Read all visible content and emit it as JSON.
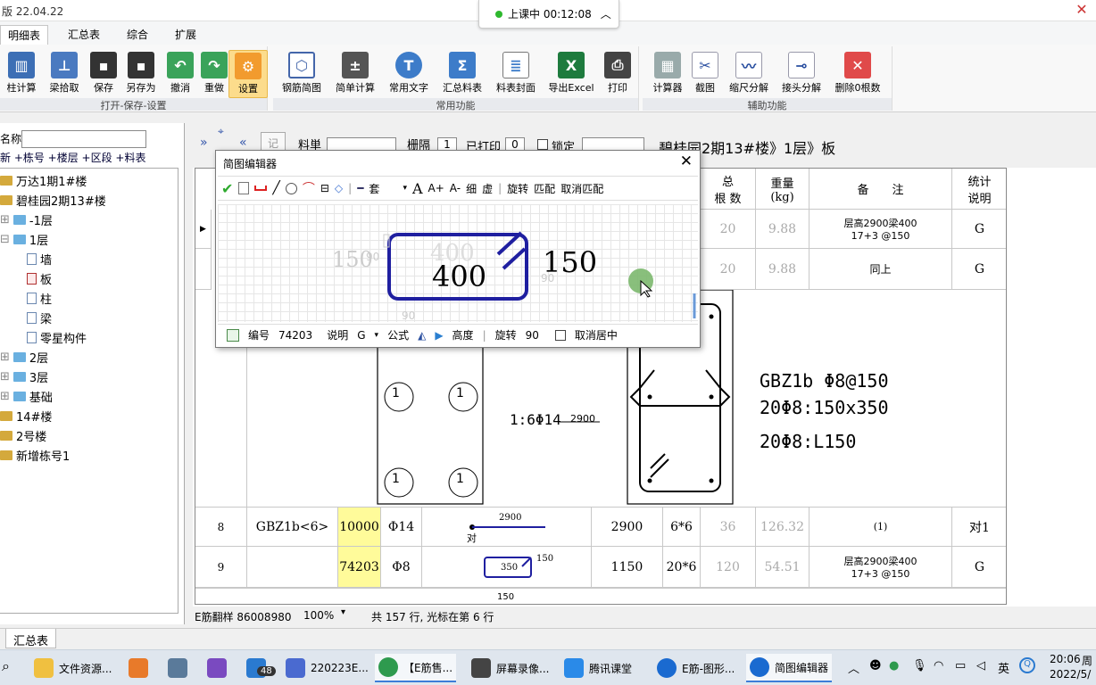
{
  "titlebar": {
    "title": "版 22.04.22"
  },
  "class_indicator": {
    "text": "上课中 00:12:08",
    "chevron": "^"
  },
  "menu_tabs": [
    "明细表",
    "汇总表",
    "综合",
    "扩展"
  ],
  "ribbon": {
    "groups": [
      {
        "label": "打开-保存-设置",
        "buttons": [
          "柱计算",
          "梁拾取",
          "保存",
          "另存为",
          "撤消",
          "重做",
          "设置"
        ]
      },
      {
        "label": "常用功能",
        "buttons": [
          "钢筋简图",
          "简单计算",
          "常用文字",
          "汇总料表",
          "料表封面",
          "导出Excel",
          "打印"
        ]
      },
      {
        "label": "辅助功能",
        "buttons": [
          "计算器",
          "截图",
          "缩尺分解",
          "接头分解",
          "删除0根数"
        ]
      }
    ]
  },
  "left_panel": {
    "search_label": "名称",
    "links": "新  +栋号  +楼层  +区段  +料表",
    "tree": [
      {
        "label": "万达1期1#楼"
      },
      {
        "label": "碧桂园2期13#楼"
      },
      {
        "label": "-1层"
      },
      {
        "label": "1层"
      },
      {
        "label": "墙"
      },
      {
        "label": "板"
      },
      {
        "label": "柱"
      },
      {
        "label": "梁"
      },
      {
        "label": "零星构件"
      },
      {
        "label": "2层"
      },
      {
        "label": "3层"
      },
      {
        "label": "基础"
      },
      {
        "label": "14#楼"
      },
      {
        "label": "2号楼"
      },
      {
        "label": "新增栋号1"
      }
    ]
  },
  "breadcrumb": {
    "labels": [
      "料単",
      "栅隔",
      "已打印",
      "锁定"
    ],
    "values": [
      "1",
      "0"
    ],
    "path": "碧桂园2期13#楼》1层》板"
  },
  "grid": {
    "headers": {
      "count": "总\n根 数",
      "weight": "重量\n(kg)",
      "remark": "备　　注",
      "stat": "统计\n说明"
    },
    "top_rows": [
      {
        "count": "20",
        "weight": "9.88",
        "remark": "层高2900梁400\n17+3 @150",
        "stat": "G"
      },
      {
        "count": "20",
        "weight": "9.88",
        "remark": "同上",
        "stat": "G"
      }
    ],
    "drawing": {
      "ratio_text": "1:6Φ14",
      "len_text": "2900",
      "notes": [
        "GBZ1b  Φ8@150",
        "20Φ8:150x350",
        "20Φ8:L150"
      ],
      "circle_mark": "1"
    },
    "rows": [
      {
        "num": "8",
        "name": "GBZ1b<6>",
        "code": "10000",
        "dia": "Φ14",
        "shape_len": "2900",
        "shape_note": "对",
        "length": "2900",
        "count_expr": "6*6",
        "count": "36",
        "weight": "126.32",
        "remark": "(1)",
        "stat": "对1"
      },
      {
        "num": "9",
        "name": "",
        "code": "74203",
        "dia": "Φ8",
        "shape_w": "350",
        "shape_h": "150",
        "length": "1150",
        "count_expr": "20*6",
        "count": "120",
        "weight": "54.51",
        "remark": "层高2900梁400\n17+3 @150",
        "stat": "G"
      }
    ],
    "partial_row_text": "150"
  },
  "statusbar": {
    "left": "E筋翻样 86008980",
    "zoom": "100%",
    "info": "共 157 行, 光标在第 6 行"
  },
  "bottom_tab": "汇总表",
  "dialog": {
    "title": "简图编辑器",
    "toolbar": [
      "套",
      "A",
      "A+",
      "A-",
      "细",
      "虚",
      "旋转",
      "匹配",
      "取消匹配"
    ],
    "shape": {
      "width_label": "400",
      "height_label": "150",
      "ghost_labels": [
        "150",
        "400",
        "90",
        "90",
        "90"
      ]
    },
    "bottom": {
      "code_label": "编号",
      "code": "74203",
      "desc_label": "说明",
      "desc": "G",
      "formula": "公式",
      "height": "高度",
      "rotate_label": "旋转",
      "rotate": "90",
      "uncenter": "取消居中"
    }
  },
  "taskbar": {
    "items": [
      "文件资源...",
      "220223E...",
      "【E筋售...",
      "屏幕录像...",
      "腾讯课堂",
      "E筋-图形...",
      "简图编辑器"
    ],
    "badge": "48",
    "ime": "英",
    "time": "20:06",
    "date": "2022/5/",
    "weekday": "周"
  },
  "colors": {
    "accent": "#1a237e",
    "shape_blue": "#1f1fa0",
    "yellow_cell": "#fffb9a",
    "green_check": "#2eaa2e"
  }
}
